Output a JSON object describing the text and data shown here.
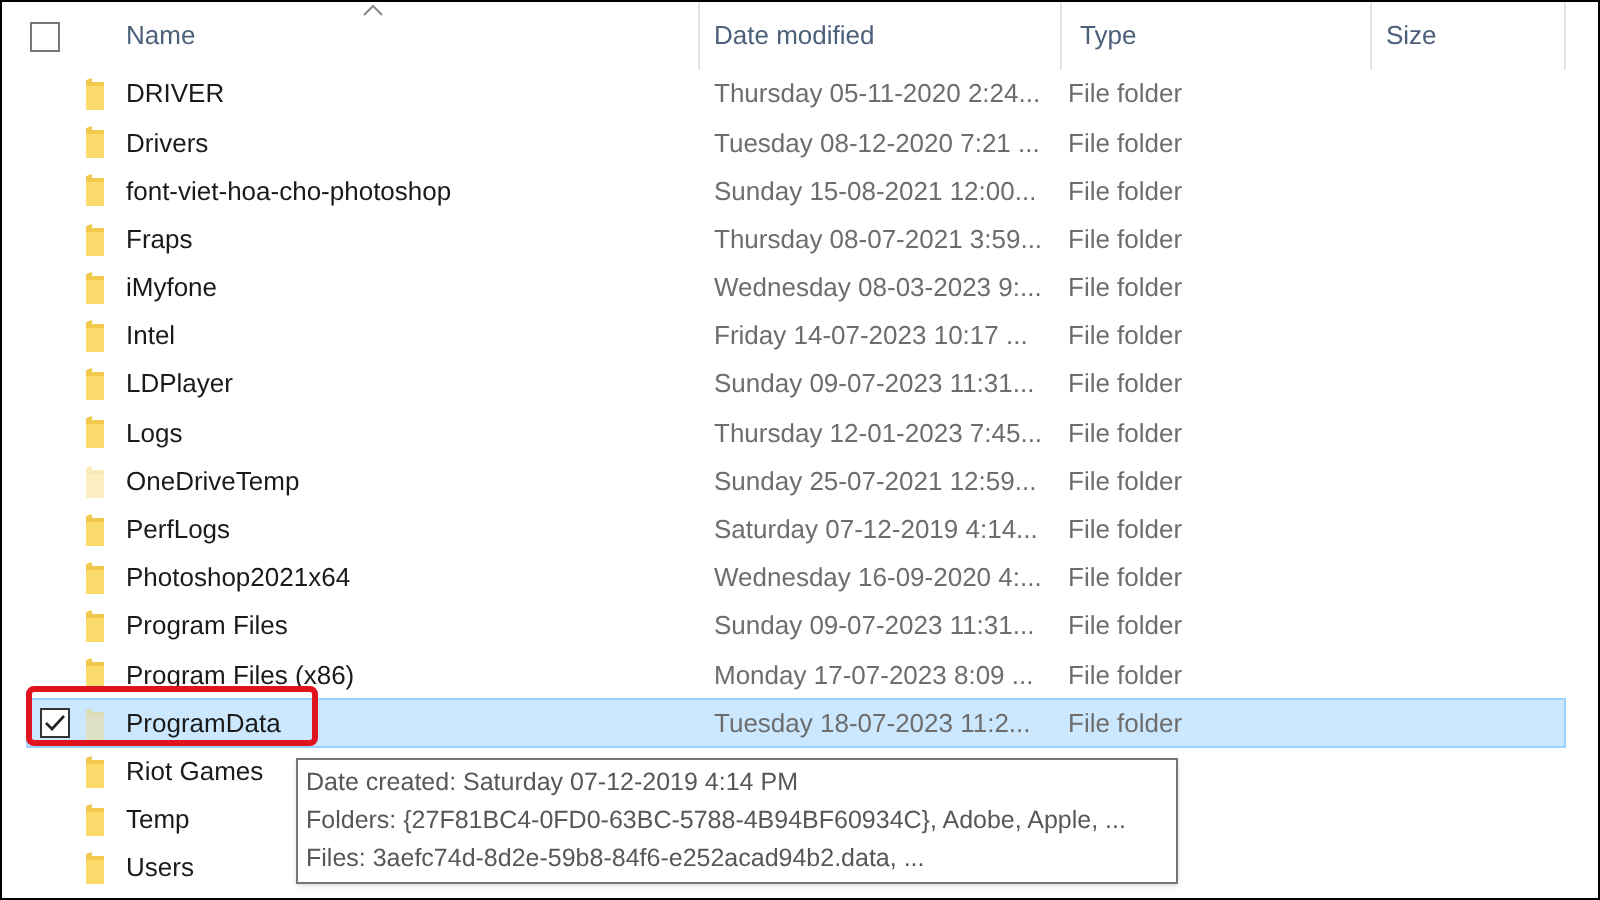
{
  "columns": [
    {
      "label": "Name",
      "sorted": true
    },
    {
      "label": "Date modified",
      "sorted": false
    },
    {
      "label": "Type",
      "sorted": false
    },
    {
      "label": "Size",
      "sorted": false
    }
  ],
  "select_all": {
    "checked": false
  },
  "rows": [
    {
      "name": "DRIVER",
      "date": "Thursday 05-11-2020 2:24...",
      "type": "File folder",
      "hidden": false,
      "selected": false
    },
    {
      "name": "Drivers",
      "date": "Tuesday 08-12-2020 7:21 ...",
      "type": "File folder",
      "hidden": false,
      "selected": false
    },
    {
      "name": "font-viet-hoa-cho-photoshop",
      "date": "Sunday 15-08-2021 12:00...",
      "type": "File folder",
      "hidden": false,
      "selected": false
    },
    {
      "name": "Fraps",
      "date": "Thursday 08-07-2021 3:59...",
      "type": "File folder",
      "hidden": false,
      "selected": false
    },
    {
      "name": "iMyfone",
      "date": "Wednesday 08-03-2023 9:...",
      "type": "File folder",
      "hidden": false,
      "selected": false
    },
    {
      "name": "Intel",
      "date": "Friday 14-07-2023 10:17 ...",
      "type": "File folder",
      "hidden": false,
      "selected": false
    },
    {
      "name": "LDPlayer",
      "date": "Sunday 09-07-2023 11:31...",
      "type": "File folder",
      "hidden": false,
      "selected": false
    },
    {
      "name": "Logs",
      "date": "Thursday 12-01-2023 7:45...",
      "type": "File folder",
      "hidden": false,
      "selected": false
    },
    {
      "name": "OneDriveTemp",
      "date": "Sunday 25-07-2021 12:59...",
      "type": "File folder",
      "hidden": true,
      "selected": false
    },
    {
      "name": "PerfLogs",
      "date": "Saturday 07-12-2019 4:14...",
      "type": "File folder",
      "hidden": false,
      "selected": false
    },
    {
      "name": "Photoshop2021x64",
      "date": "Wednesday 16-09-2020 4:...",
      "type": "File folder",
      "hidden": false,
      "selected": false
    },
    {
      "name": "Program Files",
      "date": "Sunday 09-07-2023 11:31...",
      "type": "File folder",
      "hidden": false,
      "selected": false
    },
    {
      "name": "Program Files (x86)",
      "date": "Monday 17-07-2023 8:09 ...",
      "type": "File folder",
      "hidden": false,
      "selected": false
    },
    {
      "name": "ProgramData",
      "date": "Tuesday 18-07-2023 11:2...",
      "type": "File folder",
      "hidden": true,
      "selected": true
    },
    {
      "name": "Riot Games",
      "hidden": false,
      "selected": false
    },
    {
      "name": "Temp",
      "hidden": false,
      "selected": false
    },
    {
      "name": "Users",
      "hidden": false,
      "selected": false
    }
  ],
  "tooltip": {
    "lines": [
      "Date created: Saturday 07-12-2019 4:14 PM",
      "Folders: {27F81BC4-0FD0-63BC-5788-4B94BF60934C}, Adobe, Apple, ...",
      "Files: 3aefc74d-8d2e-59b8-84f6-e252acad94b2.data, ..."
    ]
  }
}
